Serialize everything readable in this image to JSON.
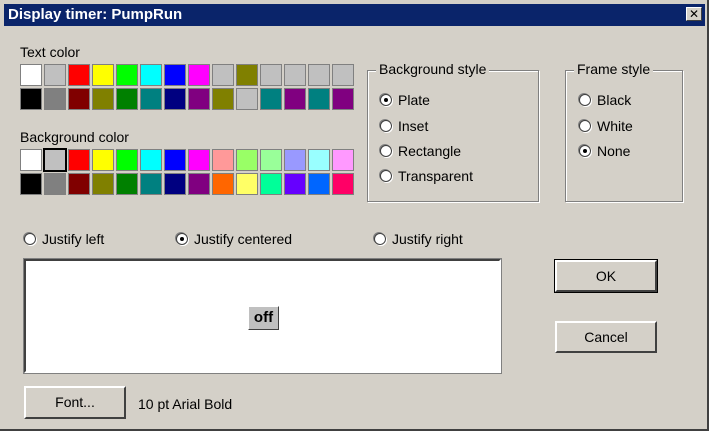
{
  "title": "Display timer: PumpRun",
  "close_icon": "close-x-icon",
  "text_color": {
    "label": "Text color",
    "rows": [
      [
        "#ffffff",
        "#c0c0c0",
        "#ff0000",
        "#ffff00",
        "#00ff00",
        "#00ffff",
        "#0000ff",
        "#ff00ff",
        "#c0c0c0",
        "#808000",
        "#c0c0c0",
        "#c0c0c0",
        "#c0c0c0",
        "#c0c0c0"
      ],
      [
        "#000000",
        "#808080",
        "#800000",
        "#808000",
        "#008000",
        "#008080",
        "#000080",
        "#800080",
        "#808000",
        "#c0c0c0",
        "#008080",
        "#800080",
        "#008080",
        "#800080"
      ]
    ]
  },
  "background_color": {
    "label": "Background color",
    "rows": [
      [
        "#ffffff",
        "#c0c0c0",
        "#ff0000",
        "#ffff00",
        "#00ff00",
        "#00ffff",
        "#0000ff",
        "#ff00ff",
        "#ff9999",
        "#99ff66",
        "#99ff99",
        "#9999ff",
        "#99ffff",
        "#ff99ff"
      ],
      [
        "#000000",
        "#808080",
        "#800000",
        "#808000",
        "#008000",
        "#008080",
        "#000080",
        "#800080",
        "#ff6600",
        "#ffff66",
        "#00ff99",
        "#6600ff",
        "#0066ff",
        "#ff0066"
      ]
    ],
    "selected": "#c0c0c0"
  },
  "background_style": {
    "label": "Background style",
    "options": [
      "Plate",
      "Inset",
      "Rectangle",
      "Transparent"
    ],
    "selected": "Plate"
  },
  "frame_style": {
    "label": "Frame style",
    "options": [
      "Black",
      "White",
      "None"
    ],
    "selected": "None"
  },
  "justify": {
    "options": [
      "Justify left",
      "Justify centered",
      "Justify right"
    ],
    "selected": "Justify centered"
  },
  "preview": {
    "text": "off"
  },
  "buttons": {
    "ok": "OK",
    "cancel": "Cancel",
    "font": "Font..."
  },
  "font_desc": "10 pt Arial Bold"
}
